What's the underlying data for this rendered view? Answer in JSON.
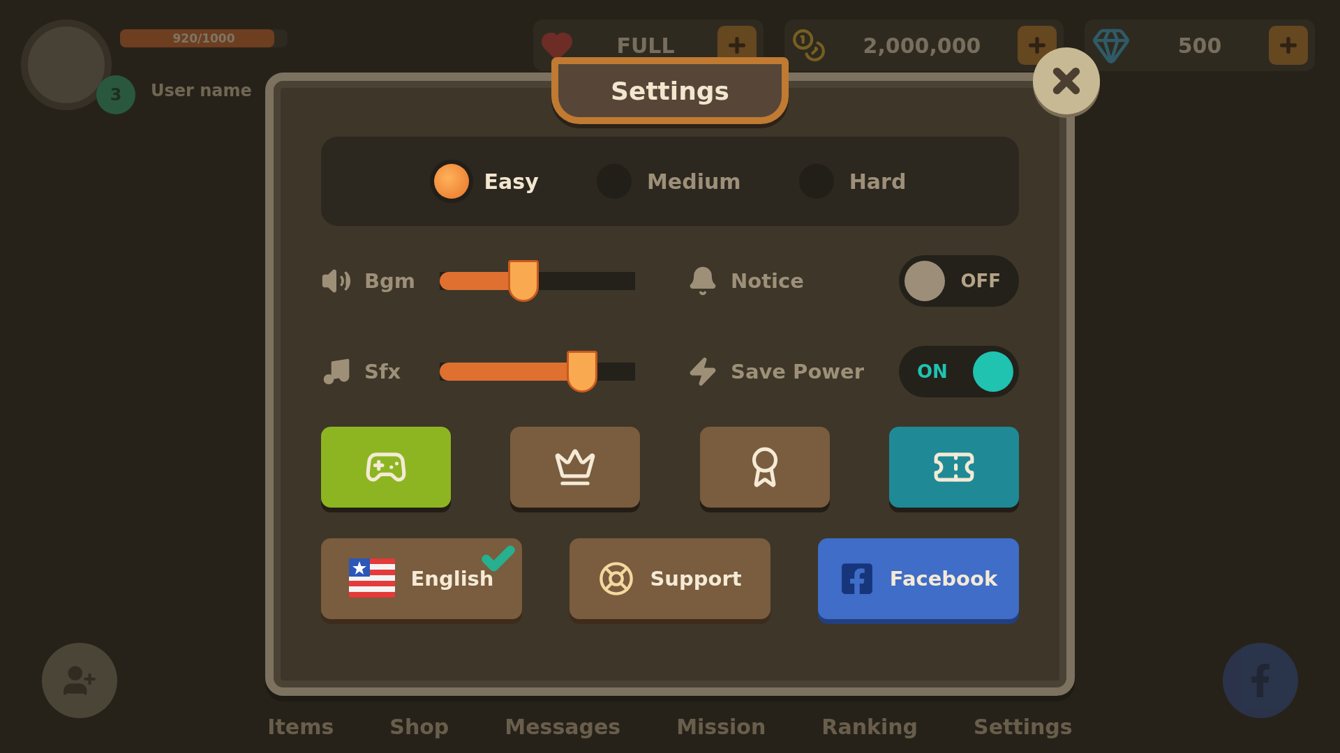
{
  "hud": {
    "level_badge": "3",
    "username": "User name",
    "xp": "920/1000",
    "level": 0.92,
    "energy": "FULL",
    "coins": "2,000,000",
    "gems": "500"
  },
  "dialog": {
    "title": "Settings",
    "difficulty": [
      {
        "label": "Easy",
        "selected": true
      },
      {
        "label": "Medium",
        "selected": false
      },
      {
        "label": "Hard",
        "selected": false
      }
    ],
    "controls": [
      {
        "kind": "slider",
        "label": "Bgm",
        "level": 0.43
      },
      {
        "kind": "toggle",
        "label": "Notice",
        "on": false,
        "state_label": "OFF"
      },
      {
        "kind": "slider",
        "label": "Sfx",
        "level": 0.73
      },
      {
        "kind": "toggle",
        "label": "Save Power",
        "on": true,
        "state_label": "ON"
      }
    ],
    "shortcuts": [
      {
        "color": "#8db522"
      },
      {
        "color": "#7a5c3e"
      },
      {
        "color": "#7a5c3e"
      },
      {
        "color": "#1f8a96"
      }
    ],
    "links": [
      {
        "kind": "language",
        "label": "English",
        "checked": true
      },
      {
        "kind": "support",
        "label": "Support"
      },
      {
        "kind": "facebook",
        "label": "Facebook"
      }
    ]
  },
  "nav": [
    {
      "label": "Items"
    },
    {
      "label": "Shop"
    },
    {
      "label": "Messages"
    },
    {
      "label": "Mission"
    },
    {
      "label": "Ranking"
    },
    {
      "label": "Settings"
    }
  ]
}
